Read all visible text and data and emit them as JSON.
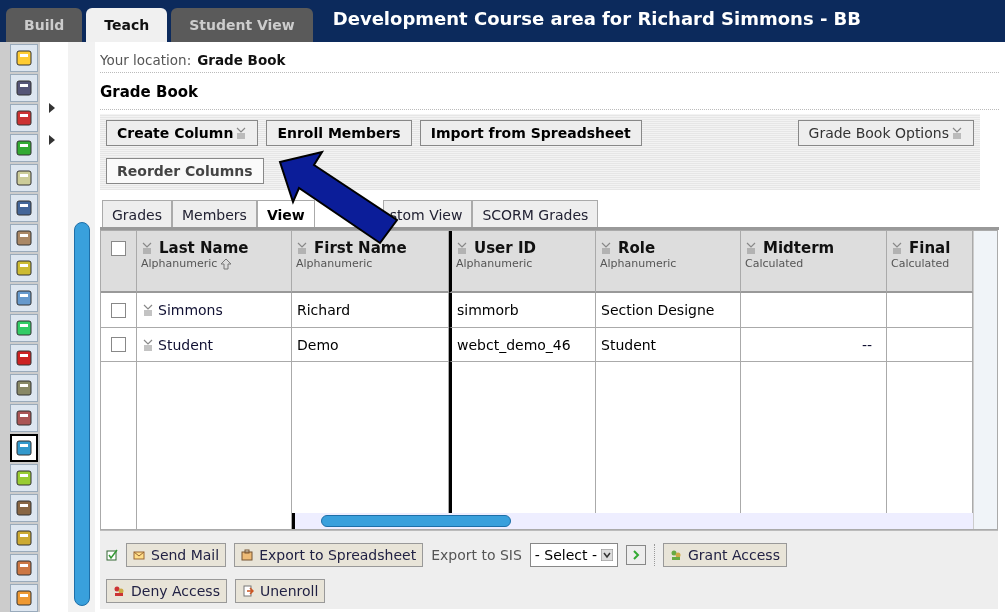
{
  "top_tabs": [
    {
      "label": "Build",
      "selected": false
    },
    {
      "label": "Teach",
      "selected": true
    },
    {
      "label": "Student View",
      "selected": false
    }
  ],
  "window": {
    "title": "Development Course area for Richard Simmons - BB"
  },
  "sidebar_tools": [
    {
      "kind": "note",
      "selected": false
    },
    {
      "kind": "pin",
      "selected": false
    },
    {
      "kind": "apple",
      "selected": false
    },
    {
      "kind": "page",
      "selected": false
    },
    {
      "kind": "mail",
      "selected": false
    },
    {
      "kind": "pages",
      "selected": false
    },
    {
      "kind": "people",
      "selected": false
    },
    {
      "kind": "scorm",
      "selected": false
    },
    {
      "kind": "search",
      "selected": false
    },
    {
      "kind": "collapse",
      "selected": false
    },
    {
      "kind": "toolbox",
      "selected": false
    },
    {
      "kind": "clock",
      "selected": false
    },
    {
      "kind": "user",
      "selected": false
    },
    {
      "kind": "palette",
      "selected": true
    },
    {
      "kind": "grid",
      "selected": false
    },
    {
      "kind": "book",
      "selected": false
    },
    {
      "kind": "chart",
      "selected": false
    },
    {
      "kind": "doc",
      "selected": false
    },
    {
      "kind": "org",
      "selected": false
    }
  ],
  "location": {
    "label": "Your location:",
    "value": "Grade Book"
  },
  "heading": "Grade Book",
  "toolbar": [
    {
      "label": "Create Column",
      "kind": "menu"
    },
    {
      "label": "Enroll Members",
      "kind": "plain"
    },
    {
      "label": "Import from Spreadsheet",
      "kind": "plain"
    },
    {
      "label": "Reorder Columns",
      "kind": "light"
    }
  ],
  "options_button": {
    "label": "Grade Book Options"
  },
  "tabs": [
    {
      "label": "Grades",
      "selected": false
    },
    {
      "label": "Members",
      "selected": false
    },
    {
      "label": "View",
      "selected": true
    },
    {
      "label": "stom View",
      "selected": false
    },
    {
      "label": "SCORM Grades",
      "selected": false
    }
  ],
  "table": {
    "header_checked": false,
    "columns": [
      {
        "title": "Last Name",
        "subtitle": "Alphanumeric",
        "sorted": true
      },
      {
        "title": "First Name",
        "subtitle": "Alphanumeric",
        "sorted": false
      },
      {
        "title": "User ID",
        "subtitle": "Alphanumeric",
        "sorted": false
      },
      {
        "title": "Role",
        "subtitle": "Alphanumeric",
        "sorted": false
      },
      {
        "title": "Midterm",
        "subtitle": "Calculated",
        "sorted": false
      },
      {
        "title": "Final",
        "subtitle": "Calculated",
        "sorted": false
      }
    ],
    "rows": [
      {
        "checked": false,
        "cells": [
          "Simmons",
          "Richard",
          "simmorb",
          "Section Designe",
          "",
          ""
        ]
      },
      {
        "checked": false,
        "cells": [
          "Student",
          "Demo",
          "webct_demo_46",
          "Student",
          "--",
          ""
        ]
      }
    ]
  },
  "actions": [
    {
      "label": "Send Mail",
      "kind": "mail"
    },
    {
      "label": "Export to Spreadsheet",
      "kind": "export"
    }
  ],
  "export_sis": {
    "label": "Export to SIS",
    "value": "- Select -"
  },
  "actions2": [
    {
      "label": "Grant Access",
      "kind": "grant"
    },
    {
      "label": "Deny Access",
      "kind": "deny"
    },
    {
      "label": "Unenroll",
      "kind": "unenroll"
    }
  ]
}
